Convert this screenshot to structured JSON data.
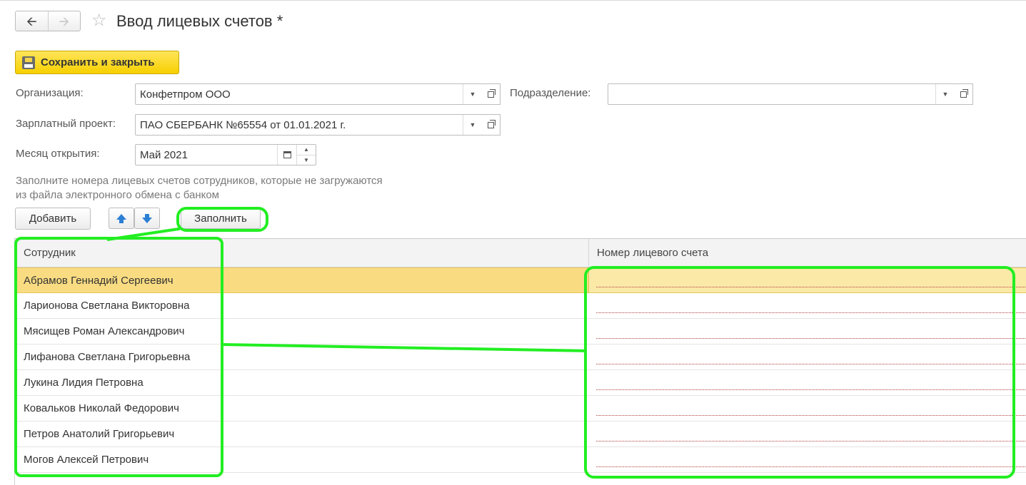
{
  "window": {
    "title": "Ввод лицевых счетов *"
  },
  "toolbar": {
    "save_close_label": "Сохранить и закрыть"
  },
  "form": {
    "organization": {
      "label": "Организация:",
      "value": "Конфетпром ООО"
    },
    "division": {
      "label": "Подразделение:",
      "value": ""
    },
    "salary_project": {
      "label": "Зарплатный проект:",
      "value": "ПАО СБЕРБАНК №65554 от 01.01.2021 г."
    },
    "open_month": {
      "label": "Месяц открытия:",
      "value": "Май 2021"
    },
    "hint": "Заполните номера лицевых счетов сотрудников, которые не загружаются из файла электронного обмена с банком"
  },
  "table_toolbar": {
    "add_label": "Добавить",
    "fill_label": "Заполнить"
  },
  "table": {
    "columns": [
      "Сотрудник",
      "Номер лицевого счета"
    ],
    "rows": [
      {
        "employee": "Абрамов Геннадий Сергеевич",
        "account": ""
      },
      {
        "employee": "Ларионова Светлана Викторовна",
        "account": ""
      },
      {
        "employee": "Мясищев Роман Александрович",
        "account": ""
      },
      {
        "employee": "Лифанова Светлана Григорьевна",
        "account": ""
      },
      {
        "employee": "Лукина Лидия Петровна",
        "account": ""
      },
      {
        "employee": "Ковальков Николай Федорович",
        "account": ""
      },
      {
        "employee": "Петров Анатолий Григорьевич",
        "account": ""
      },
      {
        "employee": "Могов Алексей Петрович",
        "account": ""
      }
    ],
    "selected_row": 0
  },
  "icons": {
    "back": "arrow-left-icon",
    "forward": "arrow-right-icon",
    "favorite": "star-icon",
    "save": "floppy-disk-icon",
    "dropdown": "chevron-down-icon",
    "open": "open-form-icon",
    "calendar": "calendar-icon",
    "move_up": "arrow-up-icon",
    "move_down": "arrow-down-icon"
  },
  "colors": {
    "save_button": "#f7d000",
    "selected_row": "#fbe9a7",
    "annotation": "#22ee22",
    "move_arrows": "#2b7fd4"
  }
}
